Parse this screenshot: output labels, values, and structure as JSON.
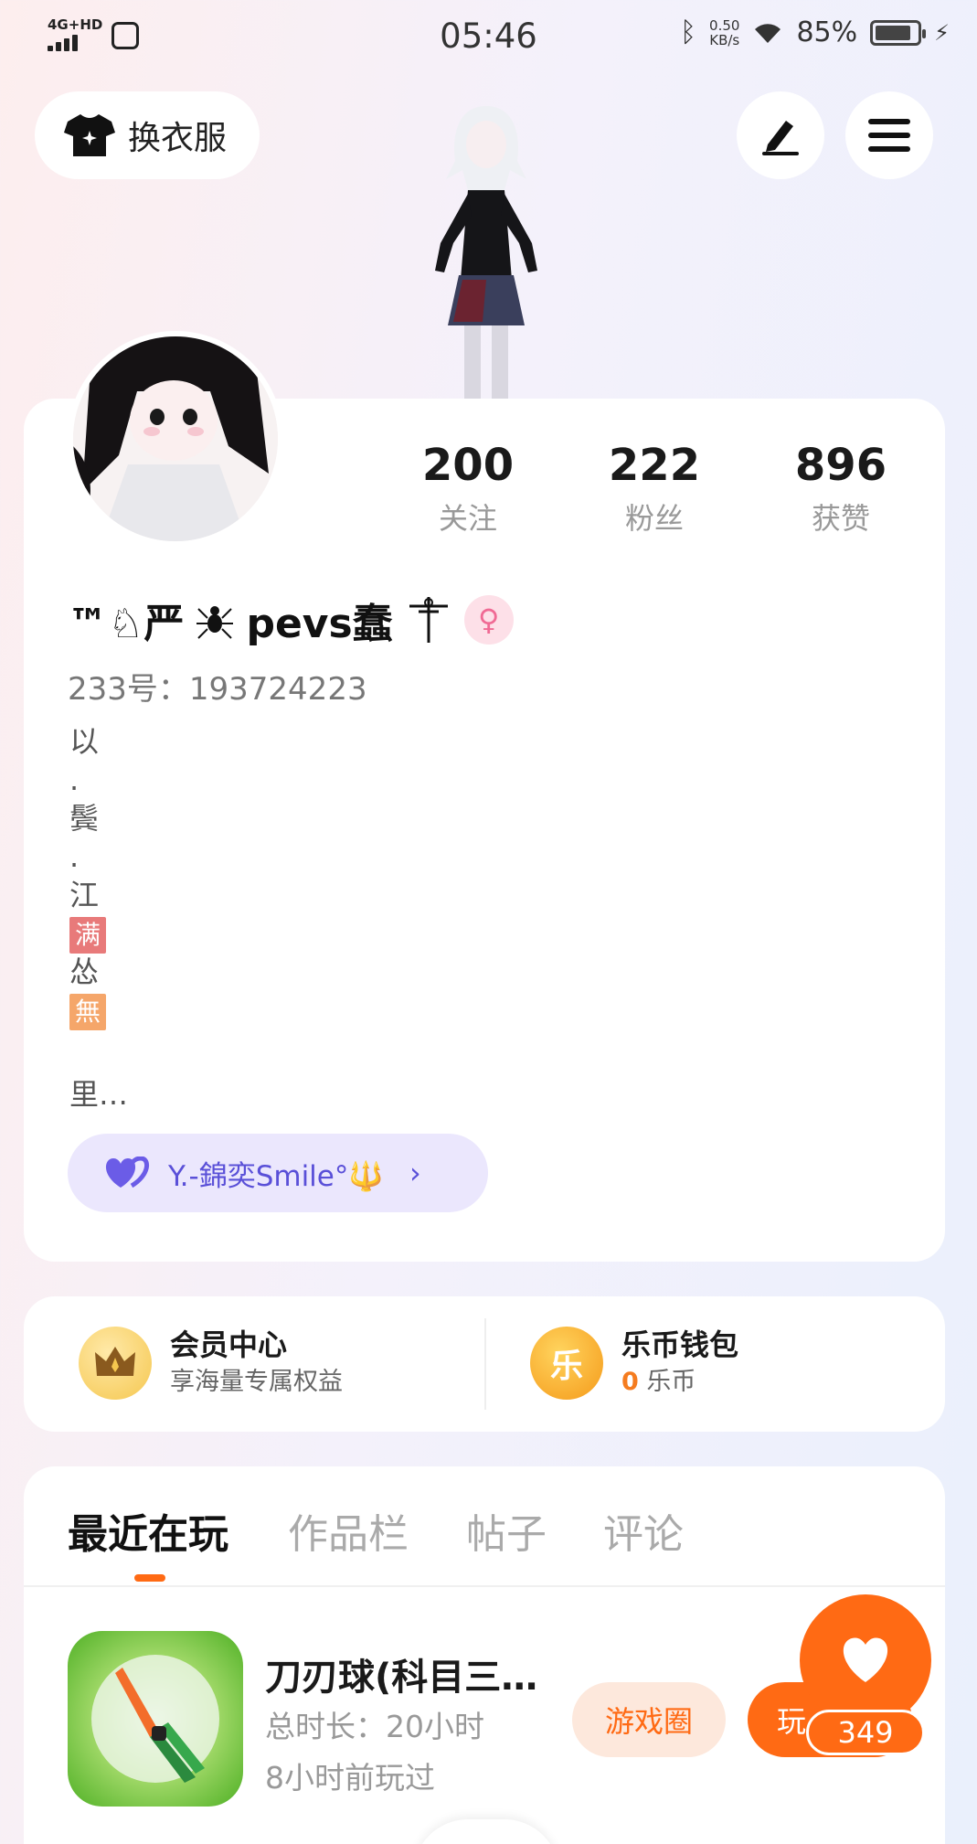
{
  "status_bar": {
    "network": "4G+HD",
    "time": "05:46",
    "speed_value": "0.50",
    "speed_unit": "KB/s",
    "battery": "85%",
    "battery_level": 0.85
  },
  "header": {
    "outfit_button": "换衣服"
  },
  "profile": {
    "stats": [
      {
        "value": "200",
        "label": "关注"
      },
      {
        "value": "222",
        "label": "粉丝"
      },
      {
        "value": "896",
        "label": "获赞"
      }
    ],
    "nickname_prefix": "™♘严",
    "nickname_mid": "pevs蠢",
    "gender_symbol": "♀",
    "uid": "233号：193724223",
    "bio_lines": [
      "以",
      ".",
      "鬓",
      ".",
      "江",
      "满",
      "怂",
      "無"
    ],
    "bio_more": "里…",
    "guild_name": "Y.-錦奕Smile°🔱"
  },
  "vip": {
    "member_title": "会员中心",
    "member_sub": "享海量专属权益",
    "wallet_title": "乐币钱包",
    "wallet_amount": "0",
    "wallet_unit": "乐币",
    "wallet_icon_char": "乐"
  },
  "tabs": [
    "最近在玩",
    "作品栏",
    "帖子",
    "评论"
  ],
  "game": {
    "title": "刀刃球(科目三…",
    "total_time": "总时长：20小时",
    "last_played": "8小时前玩过",
    "circle_button": "游戏圈",
    "play_button": "玩"
  },
  "fab": {
    "count": "349"
  },
  "colors": {
    "accent": "#ff6a14",
    "guild_bg": "#ebe7fd",
    "guild_text": "#5a50d8",
    "tag_red": "#e87a7a",
    "tag_orange": "#f5a66a"
  }
}
